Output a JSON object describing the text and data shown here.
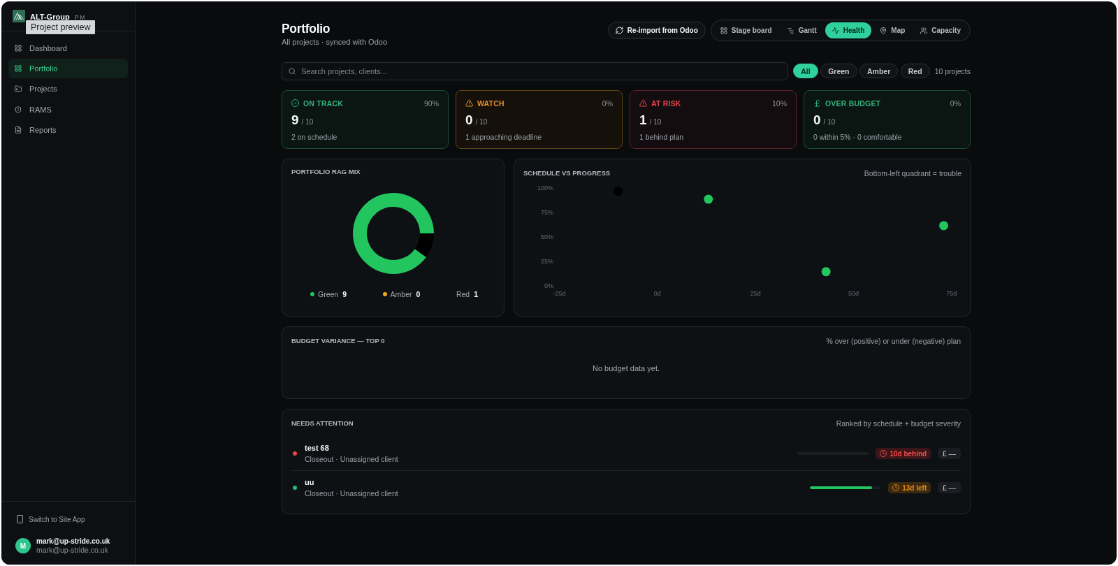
{
  "sidebar": {
    "brand": {
      "name": "ALT-Group",
      "suffix": "PM",
      "tooltip": "Project preview"
    },
    "nav": [
      {
        "label": "Dashboard",
        "selected": false
      },
      {
        "label": "Portfolio",
        "selected": true
      },
      {
        "label": "Projects",
        "selected": false
      },
      {
        "label": "RAMS",
        "selected": false
      },
      {
        "label": "Reports",
        "selected": false
      }
    ],
    "switch_app": "Switch to Site App",
    "user": {
      "initial": "M",
      "name": "mark@up-stride.co.uk",
      "email": "mark@up-stride.co.uk"
    }
  },
  "header": {
    "title": "Portfolio",
    "subtitle": "All projects · synced with Odoo",
    "reimport_button": "Re-import from Odoo",
    "views": [
      {
        "label": "Stage board",
        "selected": false
      },
      {
        "label": "Gantt",
        "selected": false
      },
      {
        "label": "Health",
        "selected": true
      },
      {
        "label": "Map",
        "selected": false
      },
      {
        "label": "Capacity",
        "selected": false
      }
    ]
  },
  "filters": {
    "search": {
      "placeholder": "Search projects, clients..."
    },
    "chips": [
      {
        "label": "All",
        "selected": true
      },
      {
        "label": "Green",
        "selected": false
      },
      {
        "label": "Amber",
        "selected": false
      },
      {
        "label": "Red",
        "selected": false
      }
    ],
    "count": "10 projects"
  },
  "stats": [
    {
      "kind": "on_track",
      "label": "ON TRACK",
      "percent": "90%",
      "value": "9",
      "total": "/ 10",
      "caption": "2 on schedule"
    },
    {
      "kind": "watch",
      "label": "WATCH",
      "percent": "0%",
      "value": "0",
      "total": "/ 10",
      "caption": "1 approaching deadline"
    },
    {
      "kind": "at_risk",
      "label": "AT RISK",
      "percent": "10%",
      "value": "1",
      "total": "/ 10",
      "caption": "1 behind plan"
    },
    {
      "kind": "over_budget",
      "label": "OVER BUDGET",
      "percent": "0%",
      "value": "0",
      "total": "/ 10",
      "caption": "0 within 5% · 0 comfortable"
    }
  ],
  "rag_mix": {
    "title": "PORTFOLIO RAG MIX",
    "chart_data": {
      "type": "donut",
      "categories": [
        "Green",
        "Amber",
        "Red"
      ],
      "values": [
        90,
        0,
        10
      ]
    },
    "legend": [
      {
        "count": "9",
        "color": "#22c55e"
      },
      {
        "count": "0",
        "color": "#f5a524"
      },
      {
        "count": "1"
      }
    ]
  },
  "schedule_vs_progress": {
    "title": "SCHEDULE VS PROGRESS",
    "note": "Bottom-left quadrant = trouble",
    "chart_data": {
      "type": "scatter",
      "x": [
        -10,
        13,
        43,
        73
      ],
      "values": [
        97,
        89,
        15,
        62
      ],
      "xlim": [
        -25,
        75
      ],
      "ylim": [
        0,
        100
      ],
      "xticks": [
        {
          "value": -25,
          "label": "-25d"
        },
        {
          "value": 0,
          "label": "0d"
        },
        {
          "value": 25,
          "label": "25d"
        },
        {
          "value": 50,
          "label": "50d"
        },
        {
          "value": 75,
          "label": "75d"
        }
      ],
      "yticks": [
        {
          "value": 100,
          "label": "100%"
        },
        {
          "value": 75,
          "label": "75%"
        },
        {
          "value": 50,
          "label": "50%"
        },
        {
          "value": 25,
          "label": "25%"
        },
        {
          "value": 0,
          "label": "0%"
        }
      ]
    },
    "points": [
      {
        "color": "#000000"
      },
      {
        "color": "#22c55e"
      },
      {
        "color": "#22c55e"
      },
      {
        "color": "#22c55e"
      }
    ]
  },
  "budget_variance": {
    "title": "BUDGET VARIANCE — TOP 0",
    "note": "% over (positive) or under (negative) plan",
    "empty_message": "No budget data yet."
  },
  "needs_attention": {
    "title": "NEEDS ATTENTION",
    "note": "Ranked by schedule + budget severity",
    "rows": [
      {
        "name": "test 68",
        "meta": "Closeout · Unassigned client",
        "color": "#ef4444",
        "schedule": {
          "kind": "overdue",
          "text": "10d behind"
        },
        "budget": "£ —"
      },
      {
        "name": "uu",
        "meta": "Closeout · Unassigned client",
        "color": "#1fbf75",
        "level": 0.87,
        "schedule": {
          "kind": "due_soon",
          "text": "13d left"
        },
        "budget": "£ —"
      }
    ]
  }
}
